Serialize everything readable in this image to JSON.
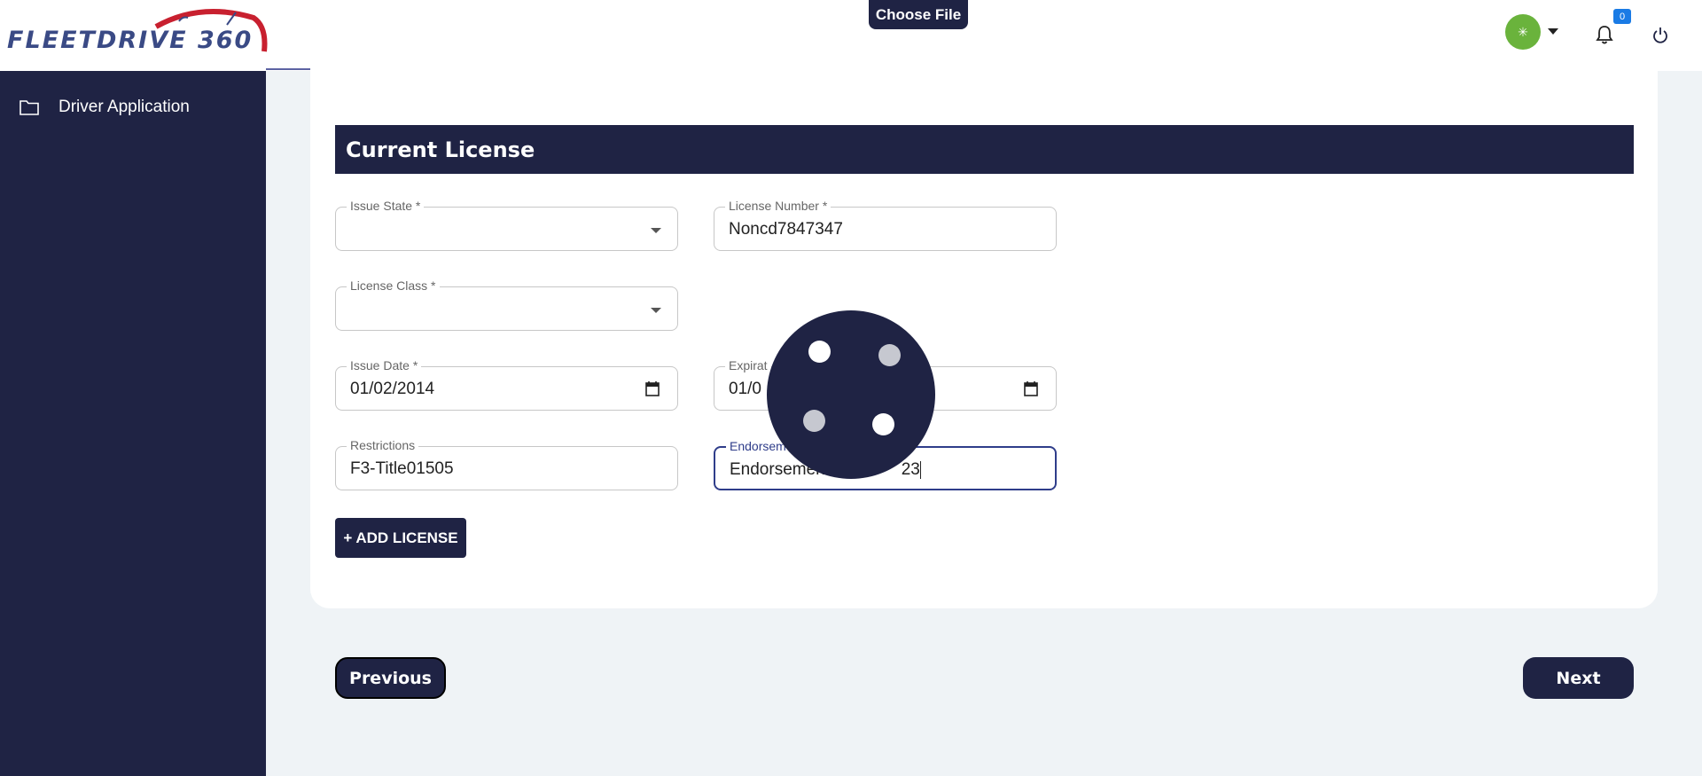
{
  "header": {
    "logo_text": "FLEETDRIVE 360",
    "choose_file_label": "Choose File",
    "avatar_glyph": "✳",
    "notification_count": "0"
  },
  "sidebar": {
    "items": [
      {
        "label": "Driver Application",
        "icon": "folder-icon"
      }
    ]
  },
  "section": {
    "title": "Current License"
  },
  "fields": {
    "issue_state": {
      "label": "Issue State *",
      "value": ""
    },
    "license_number": {
      "label": "License Number *",
      "value": "Noncd7847347"
    },
    "license_class": {
      "label": "License Class *",
      "value": ""
    },
    "issue_date": {
      "label": "Issue Date *",
      "value": "01/02/2014"
    },
    "expiration_date": {
      "label": "Expirat",
      "value": "01/0"
    },
    "restrictions": {
      "label": "Restrictions",
      "value": "F3-Title01505"
    },
    "endorsements": {
      "label": "Endorsem",
      "value": "Endorsemen",
      "value_tail": "23"
    }
  },
  "buttons": {
    "add_license": "+ ADD LICENSE",
    "previous": "Previous",
    "next": "Next"
  },
  "colors": {
    "brand_navy": "#1f2344",
    "avatar_green": "#6ab33c",
    "badge_blue": "#1a7be5",
    "focus_border": "#2f3d8a",
    "logo_red": "#c8202f"
  }
}
